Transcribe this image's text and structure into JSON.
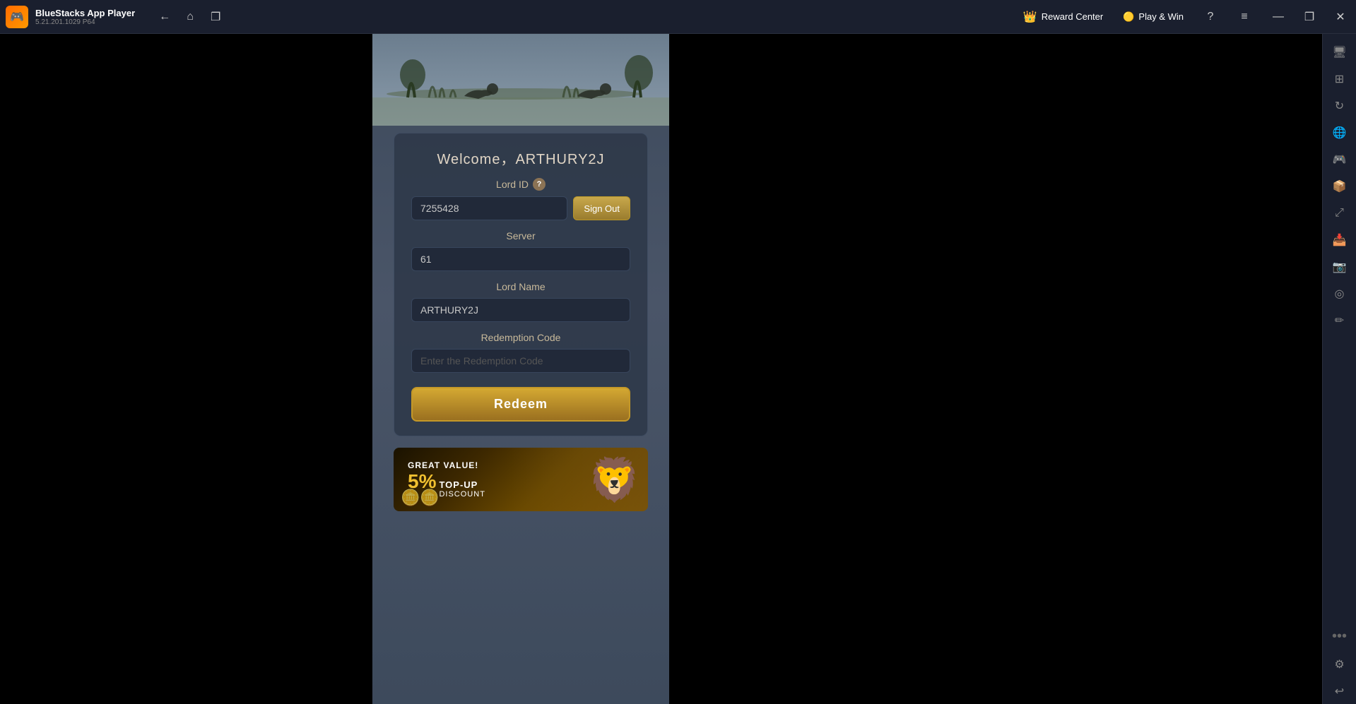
{
  "titlebar": {
    "app_name": "BlueStacks App Player",
    "app_version": "5.21.201.1029  P64",
    "logo_emoji": "🎮",
    "nav": {
      "back_label": "←",
      "home_label": "⌂",
      "multi_label": "❐"
    },
    "reward_center_label": "Reward Center",
    "reward_crown_emoji": "👑",
    "play_win_label": "Play & Win",
    "play_win_emoji": "🟡",
    "help_label": "?",
    "menu_label": "≡",
    "minimize_label": "—",
    "restore_label": "❐",
    "close_label": "✕"
  },
  "game": {
    "welcome_text": "Welcome，ARTHURY2J",
    "lord_id_label": "Lord ID",
    "lord_id_value": "7255428",
    "sign_out_label": "Sign Out",
    "server_label": "Server",
    "server_value": "61",
    "lord_name_label": "Lord Name",
    "lord_name_value": "ARTHURY2J",
    "redemption_code_label": "Redemption Code",
    "redemption_code_placeholder": "Enter the Redemption Code",
    "redeem_button_label": "Redeem",
    "banner": {
      "great_value_text": "GREAT",
      "value_text": "VALUE!",
      "percent_text": "5%",
      "topup_text": "TOP-UP",
      "discount_text": "DISCOUNT",
      "lion_emoji": "🦁"
    }
  },
  "sidebar": {
    "icons": [
      {
        "name": "sidebar-screen-icon",
        "symbol": "🖥"
      },
      {
        "name": "sidebar-layers-icon",
        "symbol": "⊞"
      },
      {
        "name": "sidebar-rotate-icon",
        "symbol": "↻"
      },
      {
        "name": "sidebar-globe-icon",
        "symbol": "🌐"
      },
      {
        "name": "sidebar-game-icon",
        "symbol": "🎮"
      },
      {
        "name": "sidebar-apk-icon",
        "symbol": "📦"
      },
      {
        "name": "sidebar-resize-icon",
        "symbol": "⤢"
      },
      {
        "name": "sidebar-import-icon",
        "symbol": "📥"
      },
      {
        "name": "sidebar-camera-icon",
        "symbol": "📷"
      },
      {
        "name": "sidebar-macro-icon",
        "symbol": "◎"
      },
      {
        "name": "sidebar-edit-icon",
        "symbol": "✏"
      },
      {
        "name": "sidebar-settings-icon",
        "symbol": "⚙"
      },
      {
        "name": "sidebar-back2-icon",
        "symbol": "↩"
      }
    ],
    "dots_label": "•••"
  }
}
